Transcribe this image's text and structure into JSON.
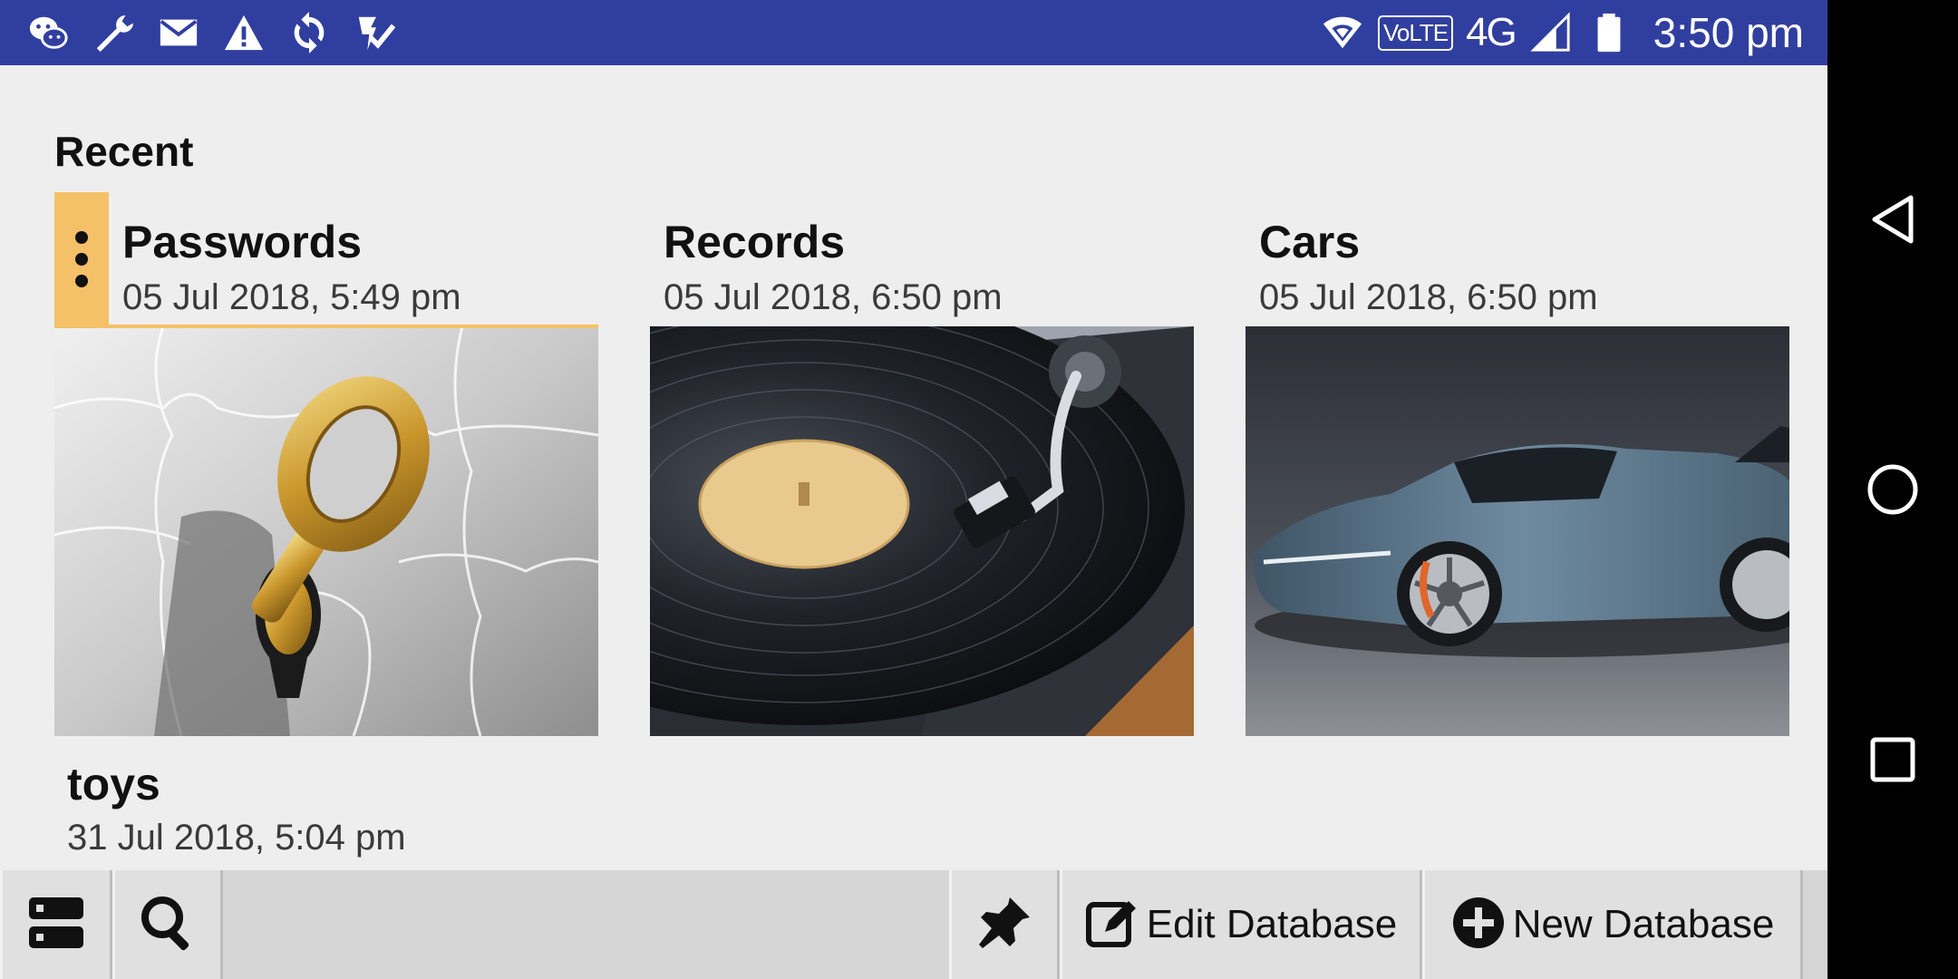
{
  "status_bar": {
    "left_icons": [
      "wechat-icon",
      "wrench-icon",
      "mail-icon",
      "warning-icon",
      "sync-icon",
      "tasks-icon"
    ],
    "right_icons": [
      "wifi-icon",
      "signal-icon",
      "battery-icon"
    ],
    "volte": "VoLTE",
    "network": "4G",
    "time": "3:50 pm",
    "background": "#303f9f"
  },
  "main": {
    "section_title": "Recent",
    "accent": "#f4c168",
    "databases": [
      {
        "name": "Passwords",
        "date": "05 Jul 2018, 5:49 pm",
        "image": "golden-key-puzzle",
        "selected": true
      },
      {
        "name": "Records",
        "date": "05 Jul 2018, 6:50 pm",
        "image": "vinyl-turntable",
        "selected": false
      },
      {
        "name": "Cars",
        "date": "05 Jul 2018, 6:50 pm",
        "image": "blue-sports-car",
        "selected": false
      },
      {
        "name": "toys",
        "date": "31 Jul 2018, 5:04 pm"
      }
    ]
  },
  "toolbar": {
    "list_icon": "database-list-icon",
    "search_icon": "search-icon",
    "pin_icon": "pin-icon",
    "edit_label": "Edit Database",
    "new_label": "New Database"
  },
  "nav_bar": {
    "icons": [
      "back-icon",
      "home-icon",
      "recents-icon"
    ]
  }
}
